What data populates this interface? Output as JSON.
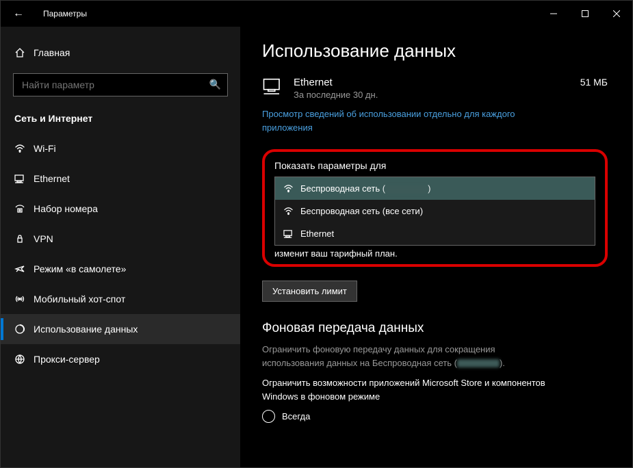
{
  "titlebar": {
    "title": "Параметры"
  },
  "sidebar": {
    "home": "Главная",
    "search_placeholder": "Найти параметр",
    "section": "Сеть и Интернет",
    "items": [
      {
        "label": "Wi-Fi"
      },
      {
        "label": "Ethernet"
      },
      {
        "label": "Набор номера"
      },
      {
        "label": "VPN"
      },
      {
        "label": "Режим «в самолете»"
      },
      {
        "label": "Мобильный хот-спот"
      },
      {
        "label": "Использование данных"
      },
      {
        "label": "Прокси-сервер"
      }
    ]
  },
  "main": {
    "page_title": "Использование данных",
    "net": {
      "name": "Ethernet",
      "period": "За последние 30 дн.",
      "amount": "51 МБ"
    },
    "link": "Просмотр сведений об использовании отдельно для каждого приложения",
    "dropdown": {
      "label": "Показать параметры для",
      "options": [
        {
          "label_pre": "Беспроводная сеть (",
          "label_post": ")"
        },
        {
          "label": "Беспроводная сеть (все сети)"
        },
        {
          "label": "Ethernet"
        }
      ]
    },
    "truncated": "изменит ваш тарифный план.",
    "set_limit_btn": "Установить лимит",
    "bg_heading": "Фоновая передача данных",
    "bg_text_pre": "Ограничить фоновую передачу данных для сокращения использования данных на Беспроводная сеть (",
    "bg_text_post": ").",
    "bg_text2": "Ограничить возможности приложений Microsoft Store и компонентов Windows в фоновом режиме",
    "radio_always": "Всегда"
  }
}
